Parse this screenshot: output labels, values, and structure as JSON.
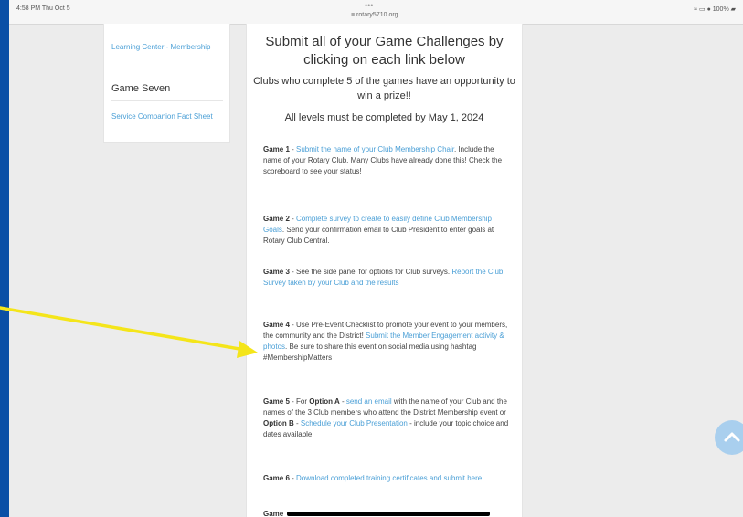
{
  "status_bar": {
    "time": "4:58 PM  Thu Oct 5",
    "dots": "•••",
    "url": "≡ rotary5710.org",
    "system": "≈ ▭ ● 100% ▰"
  },
  "sidebar": {
    "learning_center_link": "Learning Center - Membership",
    "heading": "Game Seven",
    "service_link": "Service Companion Fact Sheet"
  },
  "page": {
    "title": "Submit all of your Game Challenges by clicking on each link below",
    "subtitle": "Clubs who complete 5 of the games have an opportunity to win a prize!!",
    "deadline": "All levels must be completed by May 1, 2024"
  },
  "games": [
    {
      "label": "Game 1",
      "pre": " - ",
      "link": "Submit the name of your Club Membership Chair",
      "post": ". Include the name of your Rotary Club. Many Clubs have already done this! Check the scoreboard to see your status!"
    },
    {
      "label": "Game 2",
      "pre": " - ",
      "link": "Complete survey to create to easily define Club Membership Goals",
      "post": ". Send your confirmation email to Club President to enter goals at Rotary Club Central."
    },
    {
      "label": "Game 3",
      "pre": " - See the side panel for options for Club surveys. ",
      "link": "Report the Club Survey taken by  your Club and the results",
      "post": ""
    },
    {
      "label": "Game 4",
      "pre": " - Use Pre-Event Checklist to promote your event to your members, the community and the District! ",
      "link": "Submit the Member Engagement activity & photos",
      "post": ". Be sure to share this event on social media using hashtag #MembershipMatters"
    },
    {
      "label": "Game 5",
      "pre": " - For ",
      "optA": "Option A",
      "mid1": " - ",
      "link1": "send an email",
      "mid2": " with the name of your Club and the names of the 3 Club members who attend the District Membership event or ",
      "optB": "Option B",
      "mid3": " - ",
      "link2": "Schedule your Club Presentation",
      "post": " - include your topic choice and dates available."
    },
    {
      "label": "Game 6",
      "pre": " - ",
      "link": "Download completed training certificates and submit here",
      "post": ""
    }
  ],
  "game7_partial": "Game",
  "colors": {
    "border_blue": "#0a4fa6",
    "link_blue": "#4a9fd6",
    "annotation_arrow": "#f4e51a",
    "scroll_button": "#a9cfee"
  },
  "icons": {
    "scroll_top": "chevron-up-icon",
    "annotation": "arrow-annotation"
  }
}
